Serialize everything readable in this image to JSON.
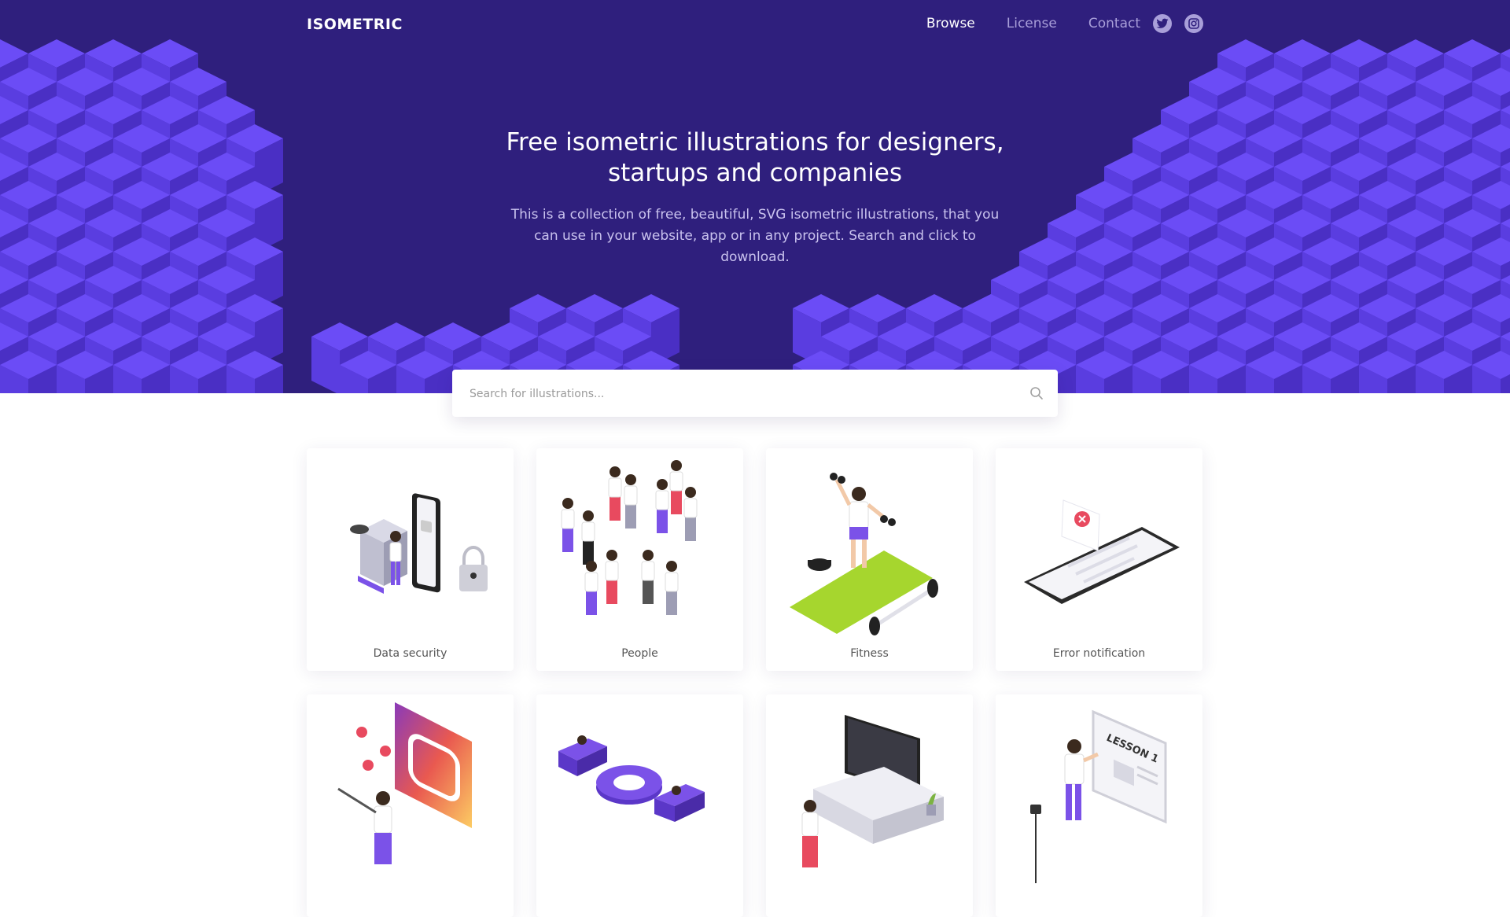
{
  "brand": {
    "logo": "ISOMETRIC"
  },
  "nav": {
    "links": [
      {
        "label": "Browse",
        "active": true
      },
      {
        "label": "License",
        "active": false
      },
      {
        "label": "Contact",
        "active": false
      }
    ],
    "social": [
      "twitter-icon",
      "instagram-icon"
    ]
  },
  "hero": {
    "title_line1": "Free isometric illustrations for designers,",
    "title_line2": "startups and companies",
    "subtitle_line1": "This is a collection of free, beautiful, SVG isometric illustrations, that you",
    "subtitle_line2": "can use in your website, app or in any project. Search and click to",
    "subtitle_line3": "download."
  },
  "search": {
    "placeholder": "Search for illustrations..."
  },
  "cards": [
    {
      "label": "Data security"
    },
    {
      "label": "People"
    },
    {
      "label": "Fitness"
    },
    {
      "label": "Error notification"
    },
    {
      "label": ""
    },
    {
      "label": ""
    },
    {
      "label": ""
    },
    {
      "label": ""
    }
  ],
  "colors": {
    "hero_bg": "#2f1f7d",
    "cube_top": "#6b4cf6",
    "cube_left": "#5a3de0",
    "cube_right": "#4a2fc4",
    "accent": "#6a45e0",
    "nav_muted": "#a99fd9"
  }
}
